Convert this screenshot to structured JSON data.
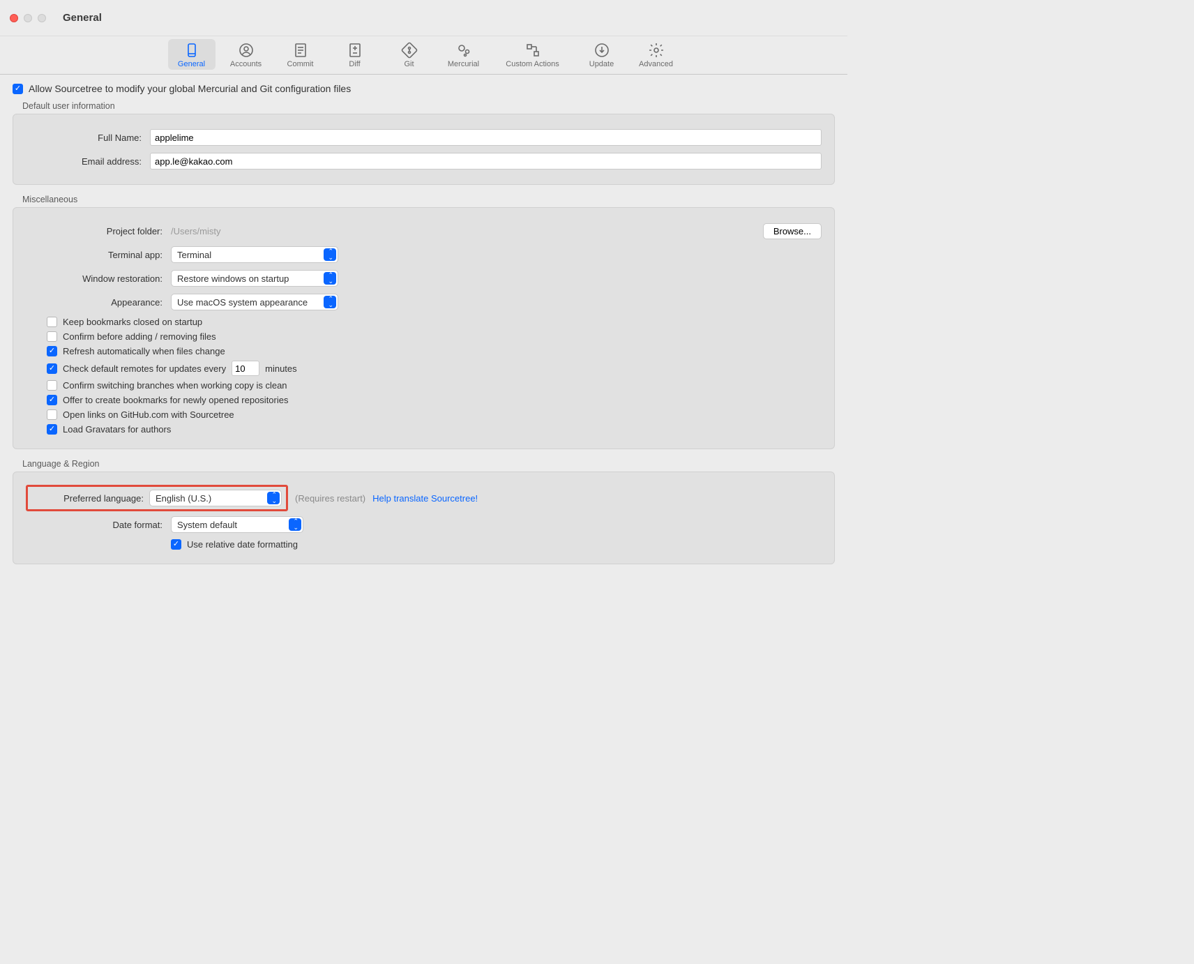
{
  "window": {
    "title": "General"
  },
  "tabs": {
    "general": "General",
    "accounts": "Accounts",
    "commit": "Commit",
    "diff": "Diff",
    "git": "Git",
    "mercurial": "Mercurial",
    "custom": "Custom Actions",
    "update": "Update",
    "advanced": "Advanced"
  },
  "allow_modify": "Allow Sourcetree to modify your global Mercurial and Git configuration files",
  "user_info": {
    "heading": "Default user information",
    "full_name_label": "Full Name:",
    "full_name_value": "applelime",
    "email_label": "Email address:",
    "email_value": "app.le@kakao.com"
  },
  "misc": {
    "heading": "Miscellaneous",
    "project_folder_label": "Project folder:",
    "project_folder_value": "/Users/misty",
    "browse": "Browse...",
    "terminal_label": "Terminal app:",
    "terminal_value": "Terminal",
    "window_restore_label": "Window restoration:",
    "window_restore_value": "Restore windows on startup",
    "appearance_label": "Appearance:",
    "appearance_value": "Use macOS system appearance",
    "cb_keep_bookmarks": "Keep bookmarks closed on startup",
    "cb_confirm_addremove": "Confirm before adding / removing files",
    "cb_refresh_auto": "Refresh automatically when files change",
    "cb_check_remotes_pre": "Check default remotes for updates every",
    "cb_check_remotes_value": "10",
    "cb_check_remotes_post": "minutes",
    "cb_confirm_switch": "Confirm switching branches when working copy is clean",
    "cb_offer_bookmarks": "Offer to create bookmarks for newly opened repositories",
    "cb_open_github": "Open links on GitHub.com with Sourcetree",
    "cb_load_gravatar": "Load Gravatars for authors"
  },
  "lang": {
    "heading": "Language & Region",
    "pref_lang_label": "Preferred language:",
    "pref_lang_value": "English (U.S.)",
    "requires_restart": "(Requires restart)",
    "help_translate": "Help translate Sourcetree!",
    "date_format_label": "Date format:",
    "date_format_value": "System default",
    "cb_relative_date": "Use relative date formatting"
  }
}
